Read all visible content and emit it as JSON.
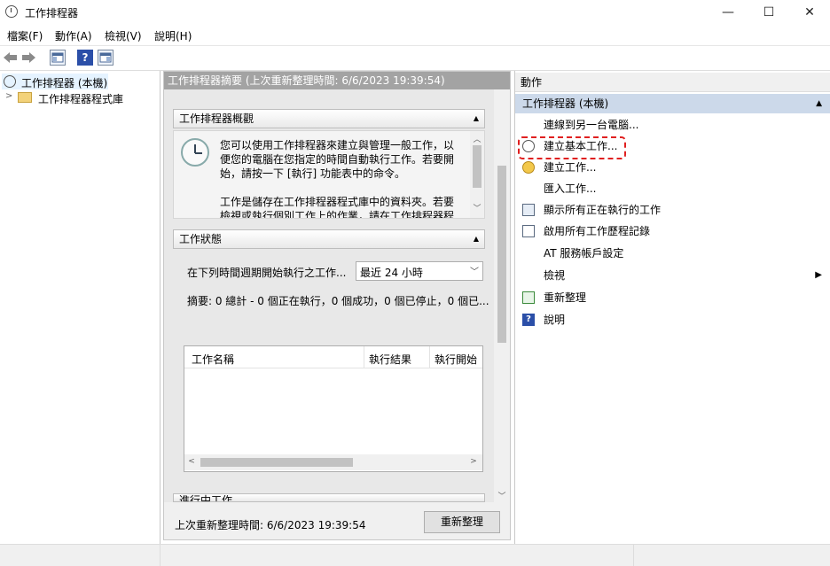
{
  "window": {
    "title": "工作排程器",
    "minimize_glyph": "—",
    "maximize_glyph": "☐",
    "close_glyph": "✕"
  },
  "menu": [
    {
      "label": "檔案(F)"
    },
    {
      "label": "動作(A)"
    },
    {
      "label": "檢視(V)"
    },
    {
      "label": "說明(H)"
    }
  ],
  "tree": {
    "root_label": "工作排程器 (本機)",
    "child_label": "工作排程器程式庫"
  },
  "center": {
    "header": "工作排程器摘要 (上次重新整理時間: 6/6/2023 19:39:54)",
    "overview": {
      "title": "工作排程器概觀",
      "paragraph1": [
        "您可以使用工作排程器來建立與管理一般工作，以",
        "便您的電腦在您指定的時間自動執行工作。若要開",
        "始，請按一下 [執行] 功能表中的命令。"
      ],
      "paragraph2": [
        "工作是儲存在工作排程器程式庫中的資料夾。若要",
        "檢視或執行個別工作上的作業，請在工作排程器程"
      ]
    },
    "status": {
      "title": "工作狀態",
      "period_label": "在下列時間週期開始執行之工作...",
      "period_value": "最近 24 小時",
      "summary": "摘要: 0 總計 - 0 個正在執行，0 個成功，0 個已停止，0 個已...",
      "columns": [
        "工作名稱",
        "執行結果",
        "執行開始"
      ]
    },
    "running": {
      "title": "進行中工作"
    },
    "footer": {
      "last_refresh": "上次重新整理時間: 6/6/2023 19:39:54",
      "refresh_button": "重新整理"
    }
  },
  "actions": {
    "header": "動作",
    "group": "工作排程器 (本機)",
    "items": [
      {
        "label": "連線到另一台電腦...",
        "icon": "none"
      },
      {
        "label": "建立基本工作...",
        "icon": "clock-icon"
      },
      {
        "label": "建立工作...",
        "icon": "new-task-icon"
      },
      {
        "label": "匯入工作...",
        "icon": "none"
      },
      {
        "label": "顯示所有正在執行的工作",
        "icon": "running-tasks-icon"
      },
      {
        "label": "啟用所有工作歷程記錄",
        "icon": "history-icon"
      },
      {
        "label": "AT 服務帳戶設定",
        "icon": "none"
      },
      {
        "label": "檢視",
        "icon": "none",
        "submenu": true
      },
      {
        "label": "重新整理",
        "icon": "refresh-icon"
      },
      {
        "label": "說明",
        "icon": "help-icon"
      }
    ]
  },
  "colors": {
    "center_header_bg": "#a3a3a3",
    "actions_group_bg": "#ccd9ea",
    "highlight": "#e02020",
    "help_blue": "#2b4fa8"
  }
}
